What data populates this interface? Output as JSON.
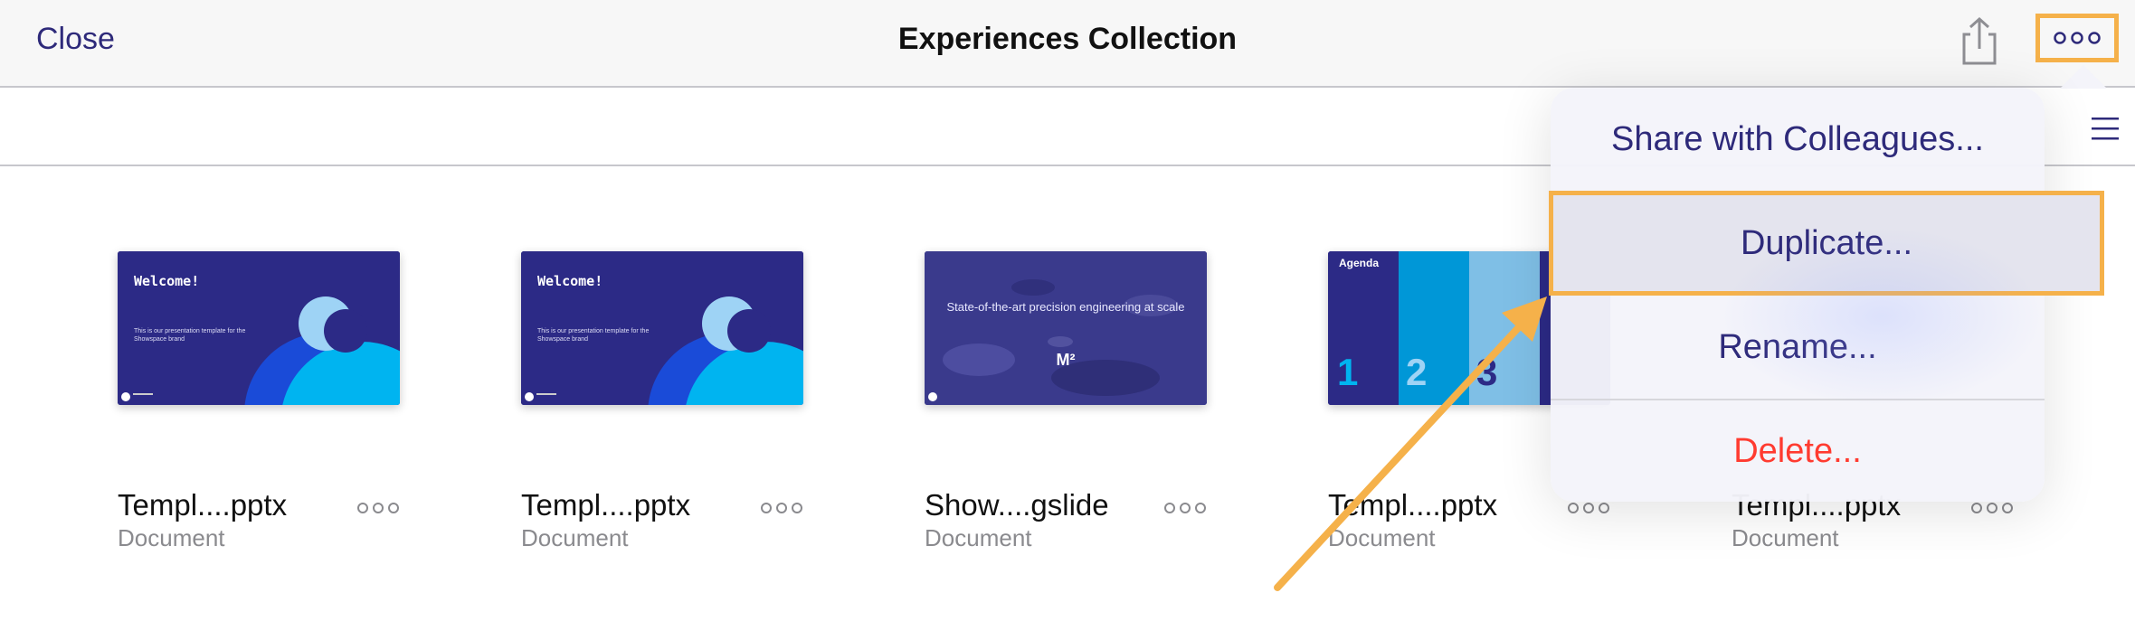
{
  "navbar": {
    "close_label": "Close",
    "title": "Experiences Collection",
    "share_icon": "share-icon",
    "more_icon": "ellipsis-icon"
  },
  "toolbar": {
    "list_icon": "list-view-icon"
  },
  "files": [
    {
      "name": "Templ....pptx",
      "type": "Document",
      "thumb": {
        "title": "Welcome!",
        "subtitle": "This is our presentation template for the Showspace brand"
      }
    },
    {
      "name": "Templ....pptx",
      "type": "Document",
      "thumb": {
        "title": "Welcome!",
        "subtitle": "This is our presentation template for the Showspace brand"
      }
    },
    {
      "name": "Show....gslide",
      "type": "Document",
      "thumb": {
        "title": "State-of-the-art precision engineering at scale",
        "subtitle": "M²"
      }
    },
    {
      "name": "Templ....pptx",
      "type": "Document",
      "thumb": {
        "title": "Agenda",
        "numbers": [
          "1",
          "2",
          "3"
        ]
      }
    },
    {
      "name": "Templ....pptx",
      "type": "Document"
    }
  ],
  "menu": {
    "items": [
      {
        "label": "Share with Colleagues..."
      },
      {
        "label": "Duplicate..."
      },
      {
        "label": "Rename..."
      },
      {
        "label": "Delete..."
      }
    ]
  },
  "colors": {
    "accent": "#2e2a7a",
    "highlight": "#f5b14a",
    "danger": "#ff3b30",
    "slide_bg": "#2c2a86"
  }
}
